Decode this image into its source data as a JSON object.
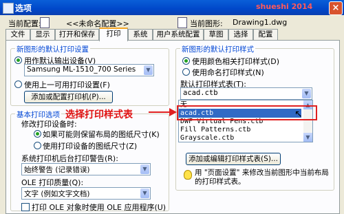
{
  "window": {
    "title": "选项",
    "watermark": "shueshi 2014",
    "close_glyph": "×"
  },
  "config": {
    "current_label": "当前配置:",
    "current_value": "<<未命名配置>>",
    "drawing_label": "当前图形:",
    "drawing_value": "Drawing1.dwg"
  },
  "tabs": [
    "文件",
    "显示",
    "打开和保存",
    "打印",
    "系统",
    "用户系统配置",
    "草图",
    "选择",
    "配置"
  ],
  "active_tab": "打印",
  "default_output": {
    "title": "新图形的默认打印设置",
    "use_as_default": "用作默认输出设备(V)",
    "device": "Samsung ML-1510_700 Series",
    "use_last": "使用上一可用打印设置(F)",
    "add_printer": "添加或配置打印机(P)..."
  },
  "basic": {
    "title": "基本打印选项",
    "paper_change_label": "修改打印设备时:",
    "keep_layout_paper": "如果可能则保留布局的图纸尺寸(K)",
    "use_device_paper": "使用打印设备的图纸尺寸(Z)",
    "spooler_label": "系统打印机后台打印警告(R):",
    "spooler_value": "始终警告 (记录错误)",
    "ole_quality_label": "OLE 打印质量(Q):",
    "ole_quality_value": "文字 (例如文字文档)",
    "ole_print": "打印 OLE 对象时使用 OLE 应用程序(U)"
  },
  "style_table": {
    "title": "新图形的默认打印样式",
    "use_color": "使用颜色相关打印样式(D)",
    "use_named": "使用命名打印样式(N)",
    "default_label": "默认打印样式表(T):",
    "default_value": "acad.ctb",
    "list": [
      "无",
      "acad.ctb",
      "DWF Virtual Pens.ctb",
      "Fill Patterns.ctb",
      "Grayscale.ctb"
    ],
    "edit_button": "添加或编辑打印样式表(S)...",
    "note": "用 \"页面设置\" 来修改当前图形中当前布局的打印样式表。"
  },
  "annotation": {
    "callout": "选择打印样式表"
  },
  "icons": {
    "dropdown": "▼",
    "scroll_up": "▲",
    "scroll_down": "▼",
    "cursor": "↖"
  }
}
